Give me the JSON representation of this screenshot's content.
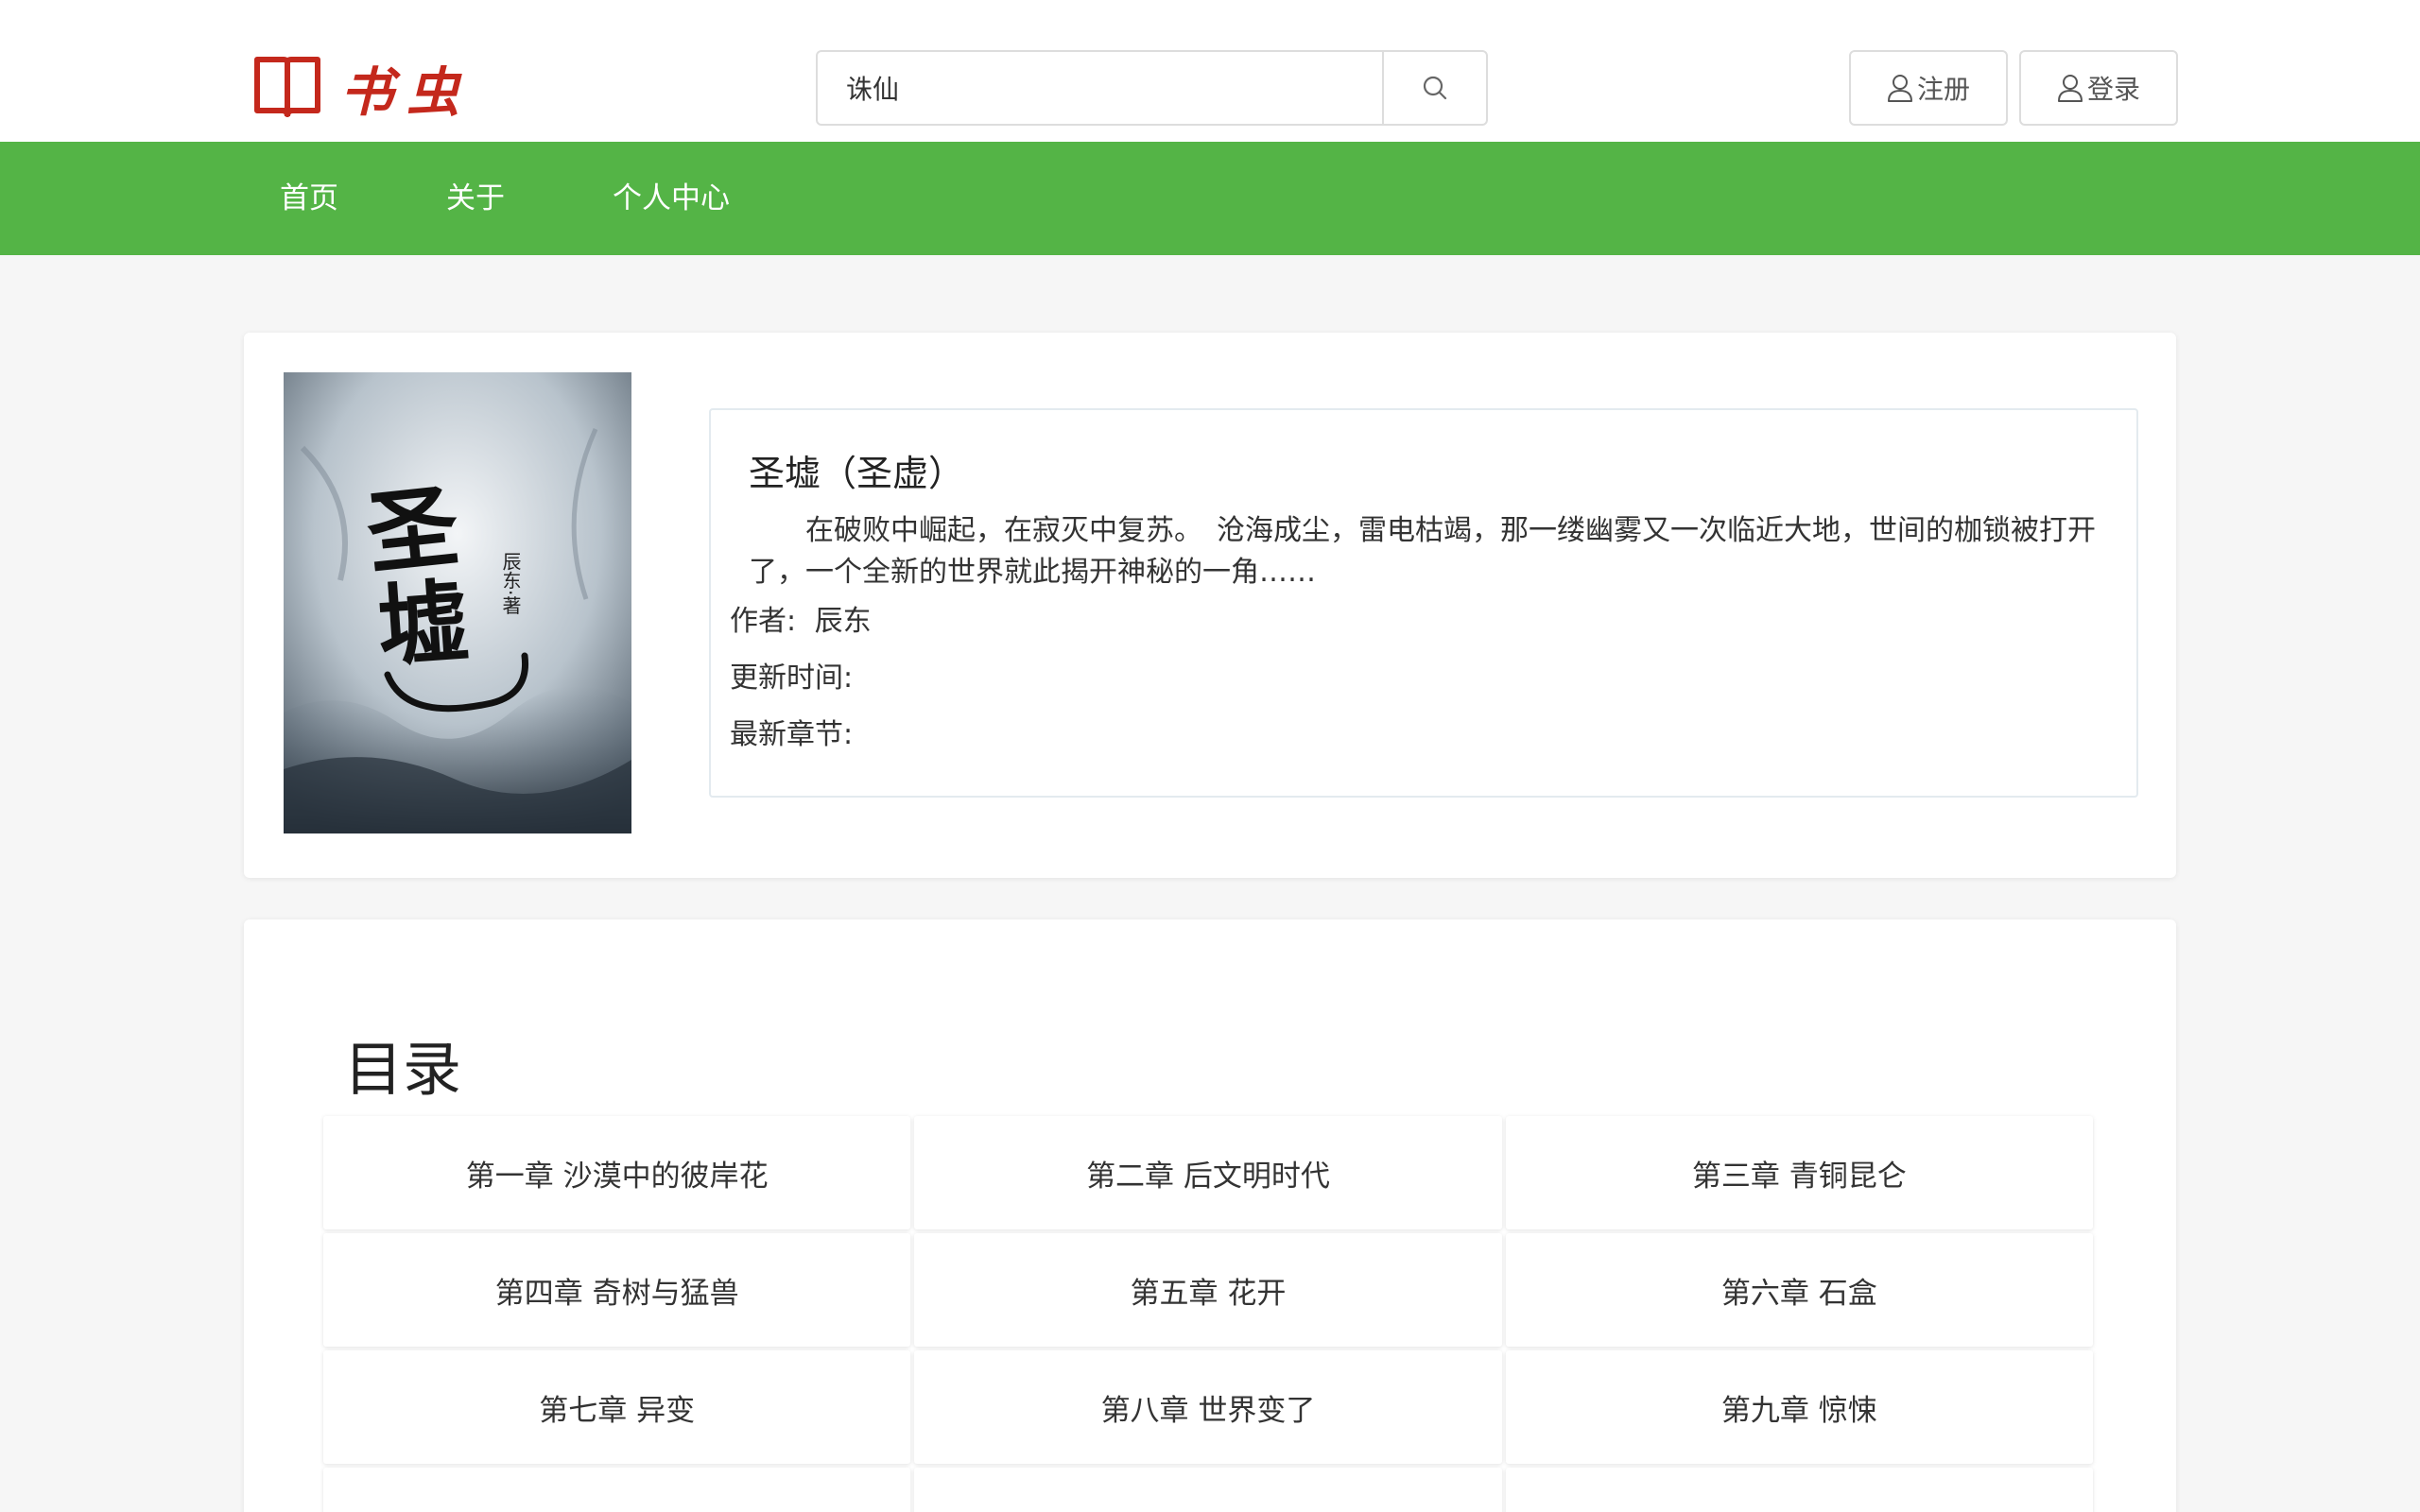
{
  "header": {
    "logo_text": "书虫",
    "search": {
      "value": "诛仙",
      "placeholder": ""
    },
    "register_label": "注册",
    "login_label": "登录"
  },
  "nav": {
    "items": [
      "首页",
      "关于",
      "个人中心"
    ]
  },
  "book": {
    "title": "圣墟（圣虚）",
    "description": "在破败中崛起，在寂灭中复苏。　沧海成尘，雷电枯竭，那一缕幽雾又一次临近大地，世间的枷锁被打开了，一个全新的世界就此揭开神秘的一角……",
    "author_label": "作者:",
    "author": "辰东",
    "update_time_label": "更新时间:",
    "update_time": "",
    "latest_chapter_label": "最新章节:",
    "latest_chapter": "",
    "cover_title": "圣墟",
    "cover_author": "辰东·著"
  },
  "toc": {
    "title": "目录",
    "chapters": [
      "第一章 沙漠中的彼岸花",
      "第二章 后文明时代",
      "第三章 青铜昆仑",
      "第四章 奇树与猛兽",
      "第五章 花开",
      "第六章 石盒",
      "第七章 异变",
      "第八章 世界变了",
      "第九章 惊悚",
      "",
      "",
      ""
    ]
  }
}
